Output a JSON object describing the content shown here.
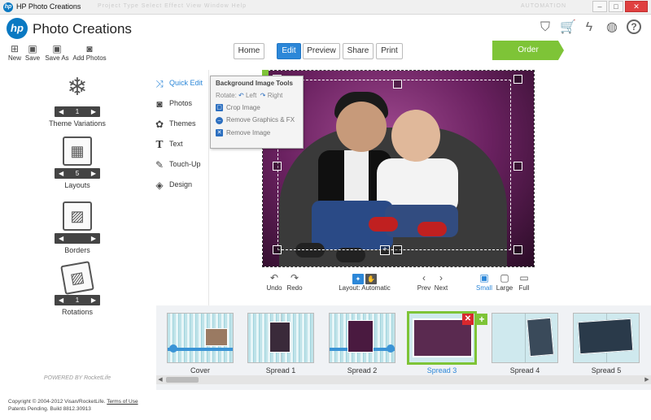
{
  "window": {
    "title": "HP Photo Creations",
    "app_icon": "hp-icon",
    "ghost_menu": "Project   Type   Select   Effect   View   Window   Help",
    "ghost_right": "AUTOMATION"
  },
  "header": {
    "logo_text": "hp",
    "app_name": "Photo Creations",
    "icons": [
      "tag-icon",
      "cart-icon",
      "lightning-icon",
      "globe-icon",
      "help-icon"
    ]
  },
  "toolbar": {
    "new": "New",
    "save": "Save",
    "save_as": "Save As",
    "add_photos": "Add Photos"
  },
  "nav": {
    "home": "Home",
    "edit": "Edit",
    "preview": "Preview",
    "share": "Share",
    "print": "Print",
    "order": "Order",
    "active": "Edit"
  },
  "left_panel": {
    "theme_variations": {
      "label": "Theme Variations",
      "value": "1"
    },
    "layouts": {
      "label": "Layouts",
      "value": "5"
    },
    "borders": {
      "label": "Borders",
      "value": ""
    },
    "rotations": {
      "label": "Rotations",
      "value": "1"
    },
    "powered_by": "POWERED BY RocketLife",
    "copyright": "Copyright © 2004-2012 Visan/RocketLife.",
    "terms": "Terms of Use",
    "patents": "Patents Pending. Build 8812.30913"
  },
  "side_tools": {
    "items": [
      {
        "label": "Quick Edit",
        "icon": "shuffle-icon",
        "active": true
      },
      {
        "label": "Photos",
        "icon": "camera-icon",
        "active": false
      },
      {
        "label": "Themes",
        "icon": "palette-icon",
        "active": false
      },
      {
        "label": "Text",
        "icon": "text-icon",
        "active": false
      },
      {
        "label": "Touch-Up",
        "icon": "brush-icon",
        "active": false
      },
      {
        "label": "Design",
        "icon": "layers-icon",
        "active": false
      }
    ]
  },
  "popup": {
    "title": "Background Image Tools",
    "rotate": "Rotate:",
    "left": "Left",
    "right": "Right",
    "crop": "Crop Image",
    "remove_fx": "Remove Graphics & FX",
    "remove_image": "Remove Image"
  },
  "canvas_controls": {
    "undo": "Undo",
    "redo": "Redo",
    "layout_automatic": "Layout: Automatic",
    "prev": "Prev",
    "next": "Next",
    "small": "Small",
    "large": "Large",
    "full": "Full",
    "active_size": "Small"
  },
  "filmstrip": {
    "spreads": [
      "Cover",
      "Spread 1",
      "Spread 2",
      "Spread 3",
      "Spread 4",
      "Spread 5"
    ],
    "selected": "Spread 3"
  },
  "colors": {
    "accent": "#2c87d8",
    "order": "#7ec437",
    "delete": "#d8282e"
  }
}
